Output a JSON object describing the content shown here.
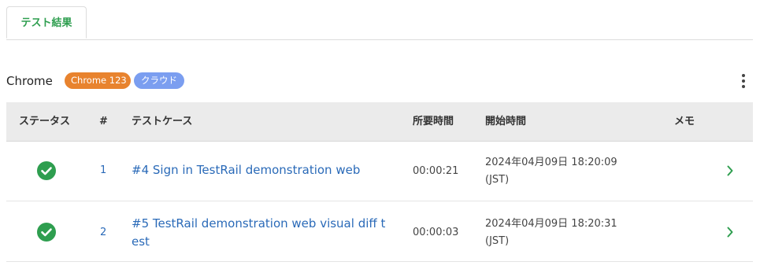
{
  "tabs": [
    {
      "label": "テスト結果",
      "active": true
    }
  ],
  "browser": {
    "name": "Chrome",
    "version_badge": "Chrome 123",
    "environment_badge": "クラウド",
    "badge_colors": {
      "version": "#e8832e",
      "environment": "#7b9ef0"
    }
  },
  "table": {
    "headers": {
      "status": "ステータス",
      "number": "#",
      "test_case": "テストケース",
      "duration": "所要時間",
      "start_time": "開始時間",
      "memo": "メモ"
    },
    "rows": [
      {
        "status": "passed",
        "status_icon": "check-circle-icon",
        "number": "1",
        "test_case": "#4 Sign in TestRail demonstration web",
        "duration": "00:00:21",
        "start_time": "2024年04月09日 18:20:09",
        "timezone": "(JST)",
        "memo": ""
      },
      {
        "status": "passed",
        "status_icon": "check-circle-icon",
        "number": "2",
        "test_case": "#5 TestRail demonstration web visual diff test",
        "duration": "00:00:03",
        "start_time": "2024年04月09日 18:20:31",
        "timezone": "(JST)",
        "memo": ""
      }
    ]
  },
  "colors": {
    "accent_green": "#2e9e4f",
    "link_blue": "#2a6ab8",
    "header_bg": "#ebebeb"
  }
}
